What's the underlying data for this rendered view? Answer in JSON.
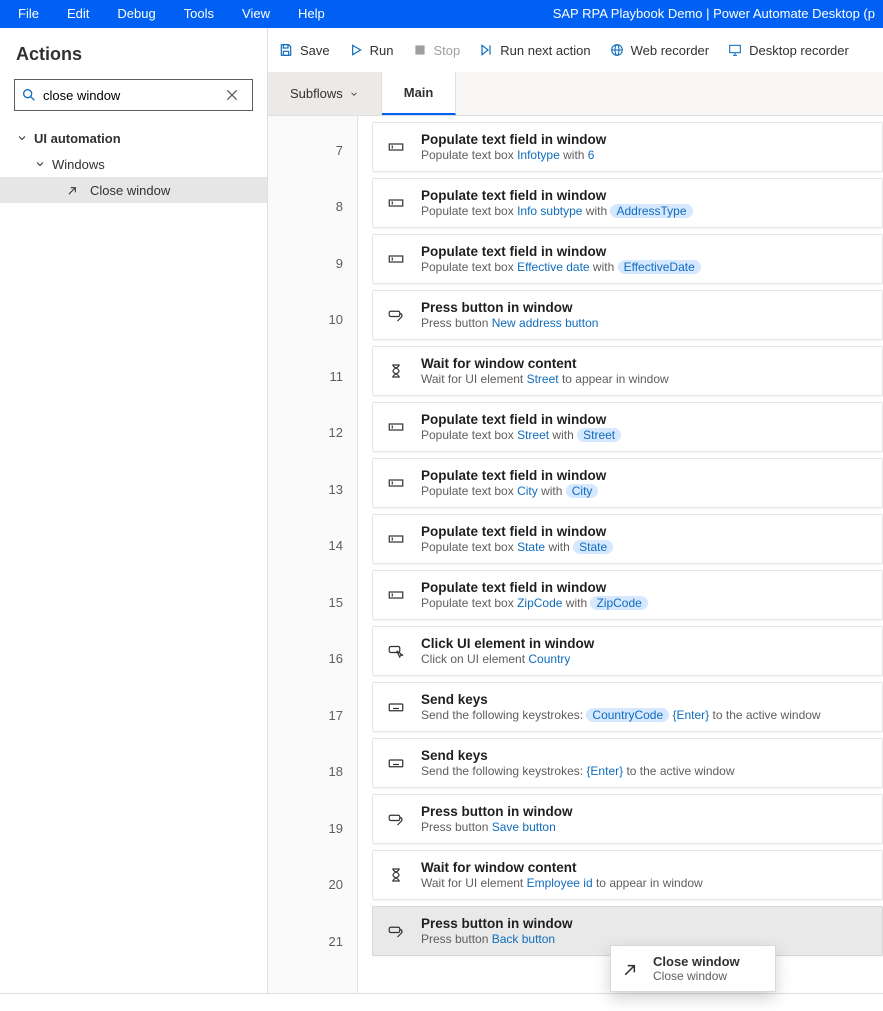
{
  "titlebar": {
    "menus": [
      "File",
      "Edit",
      "Debug",
      "Tools",
      "View",
      "Help"
    ],
    "window_title": "SAP RPA Playbook Demo | Power Automate Desktop (p"
  },
  "toolbar": {
    "save": "Save",
    "run": "Run",
    "stop": "Stop",
    "run_next": "Run next action",
    "web_recorder": "Web recorder",
    "desktop_recorder": "Desktop recorder"
  },
  "actions_panel": {
    "title": "Actions",
    "search_value": "close window",
    "tree": {
      "root": "UI automation",
      "child1": "Windows",
      "leaf": "Close window"
    }
  },
  "tabs": {
    "subflows": "Subflows",
    "main": "Main"
  },
  "steps": [
    {
      "n": "7",
      "icon": "textbox",
      "title": "Populate text field in window",
      "sub": [
        {
          "t": "Populate text box ",
          "c": "plain"
        },
        {
          "t": "Infotype",
          "c": "lk"
        },
        {
          "t": " with ",
          "c": "plain"
        },
        {
          "t": "6",
          "c": "lk"
        }
      ]
    },
    {
      "n": "8",
      "icon": "textbox",
      "title": "Populate text field in window",
      "sub": [
        {
          "t": "Populate text box ",
          "c": "plain"
        },
        {
          "t": "Info subtype",
          "c": "lk"
        },
        {
          "t": " with ",
          "c": "plain"
        },
        {
          "t": "AddressType",
          "c": "chip"
        }
      ]
    },
    {
      "n": "9",
      "icon": "textbox",
      "title": "Populate text field in window",
      "sub": [
        {
          "t": "Populate text box ",
          "c": "plain"
        },
        {
          "t": "Effective date",
          "c": "lk"
        },
        {
          "t": " with ",
          "c": "plain"
        },
        {
          "t": "EffectiveDate",
          "c": "chip"
        }
      ]
    },
    {
      "n": "10",
      "icon": "press",
      "title": "Press button in window",
      "sub": [
        {
          "t": "Press button ",
          "c": "plain"
        },
        {
          "t": "New address button",
          "c": "lk"
        }
      ]
    },
    {
      "n": "11",
      "icon": "wait",
      "title": "Wait for window content",
      "sub": [
        {
          "t": "Wait for UI element ",
          "c": "plain"
        },
        {
          "t": "Street",
          "c": "lk"
        },
        {
          "t": " to appear in window",
          "c": "plain"
        }
      ]
    },
    {
      "n": "12",
      "icon": "textbox",
      "title": "Populate text field in window",
      "sub": [
        {
          "t": "Populate text box ",
          "c": "plain"
        },
        {
          "t": "Street",
          "c": "lk"
        },
        {
          "t": " with ",
          "c": "plain"
        },
        {
          "t": "Street",
          "c": "chip"
        }
      ]
    },
    {
      "n": "13",
      "icon": "textbox",
      "title": "Populate text field in window",
      "sub": [
        {
          "t": "Populate text box ",
          "c": "plain"
        },
        {
          "t": "City",
          "c": "lk"
        },
        {
          "t": " with ",
          "c": "plain"
        },
        {
          "t": "City",
          "c": "chip"
        }
      ]
    },
    {
      "n": "14",
      "icon": "textbox",
      "title": "Populate text field in window",
      "sub": [
        {
          "t": "Populate text box ",
          "c": "plain"
        },
        {
          "t": "State",
          "c": "lk"
        },
        {
          "t": " with ",
          "c": "plain"
        },
        {
          "t": "State",
          "c": "chip"
        }
      ]
    },
    {
      "n": "15",
      "icon": "textbox",
      "title": "Populate text field in window",
      "sub": [
        {
          "t": "Populate text box ",
          "c": "plain"
        },
        {
          "t": "ZipCode",
          "c": "lk"
        },
        {
          "t": " with ",
          "c": "plain"
        },
        {
          "t": "ZipCode",
          "c": "chip"
        }
      ]
    },
    {
      "n": "16",
      "icon": "click",
      "title": "Click UI element in window",
      "sub": [
        {
          "t": "Click on UI element ",
          "c": "plain"
        },
        {
          "t": "Country",
          "c": "lk"
        }
      ]
    },
    {
      "n": "17",
      "icon": "keys",
      "title": "Send keys",
      "sub": [
        {
          "t": "Send the following keystrokes: ",
          "c": "plain"
        },
        {
          "t": "CountryCode",
          "c": "chip"
        },
        {
          "t": " ",
          "c": "plain"
        },
        {
          "t": "{Enter}",
          "c": "chip2"
        },
        {
          "t": " to the active window",
          "c": "plain"
        }
      ]
    },
    {
      "n": "18",
      "icon": "keys",
      "title": "Send keys",
      "sub": [
        {
          "t": "Send the following keystrokes: ",
          "c": "plain"
        },
        {
          "t": "{Enter}",
          "c": "chip2"
        },
        {
          "t": " to the active window",
          "c": "plain"
        }
      ]
    },
    {
      "n": "19",
      "icon": "press",
      "title": "Press button in window",
      "sub": [
        {
          "t": "Press button ",
          "c": "plain"
        },
        {
          "t": "Save button",
          "c": "lk"
        }
      ]
    },
    {
      "n": "20",
      "icon": "wait",
      "title": "Wait for window content",
      "sub": [
        {
          "t": "Wait for UI element ",
          "c": "plain"
        },
        {
          "t": "Employee id",
          "c": "lk"
        },
        {
          "t": " to appear in window",
          "c": "plain"
        }
      ]
    },
    {
      "n": "21",
      "icon": "press",
      "title": "Press button in window",
      "selected": true,
      "sub": [
        {
          "t": "Press button ",
          "c": "plain"
        },
        {
          "t": "Back button",
          "c": "lk"
        }
      ]
    }
  ],
  "tooltip": {
    "title": "Close window",
    "sub": "Close window"
  }
}
